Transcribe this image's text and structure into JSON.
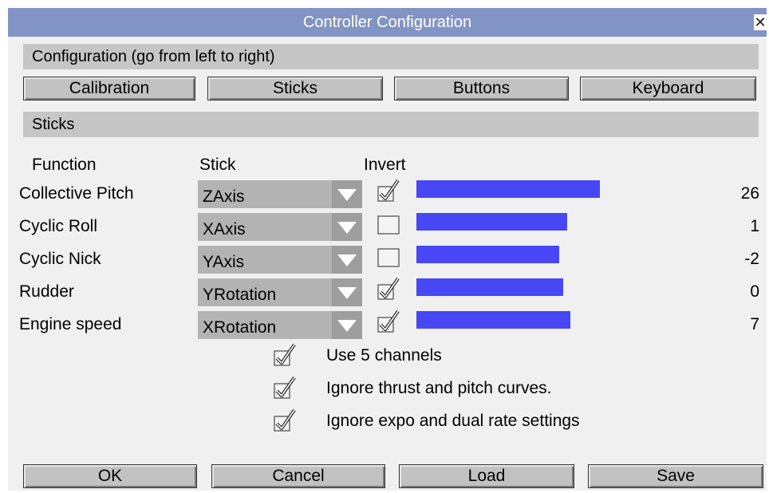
{
  "window": {
    "title": "Controller Configuration",
    "close_glyph": "✕"
  },
  "section1": {
    "label": "Configuration (go from left to right)"
  },
  "tabs": [
    {
      "label": "Calibration"
    },
    {
      "label": "Sticks"
    },
    {
      "label": "Buttons"
    },
    {
      "label": "Keyboard"
    }
  ],
  "section2": {
    "label": "Sticks"
  },
  "headers": {
    "function": "Function",
    "stick": "Stick",
    "invert": "Invert"
  },
  "rows": [
    {
      "function": "Collective Pitch",
      "stick": "ZAxis",
      "invert": true,
      "level": 26,
      "bar_fraction": 0.5,
      "value": "26"
    },
    {
      "function": "Cyclic Roll",
      "stick": "XAxis",
      "invert": false,
      "level": 1,
      "bar_fraction": 0.41,
      "value": "1"
    },
    {
      "function": "Cyclic Nick",
      "stick": "YAxis",
      "invert": false,
      "level": -2,
      "bar_fraction": 0.39,
      "value": "-2"
    },
    {
      "function": "Rudder",
      "stick": "YRotation",
      "invert": true,
      "level": 0,
      "bar_fraction": 0.4,
      "value": "0"
    },
    {
      "function": "Engine speed",
      "stick": "XRotation",
      "invert": true,
      "level": 7,
      "bar_fraction": 0.42,
      "value": "7"
    }
  ],
  "options": [
    {
      "label": "Use 5 channels",
      "checked": true
    },
    {
      "label": "Ignore thrust and pitch curves.",
      "checked": true
    },
    {
      "label": "Ignore expo and dual rate settings",
      "checked": true
    }
  ],
  "footer": {
    "ok": "OK",
    "cancel": "Cancel",
    "load": "Load",
    "save": "Save"
  },
  "colors": {
    "titlebar": "#8294c4",
    "bar": "#4747f5",
    "section": "#c6c6c6",
    "button": "#c2c2c2"
  },
  "icons": {
    "close": "close-icon",
    "dropdown": "dropdown-arrow-icon",
    "check": "checkmark-icon"
  }
}
